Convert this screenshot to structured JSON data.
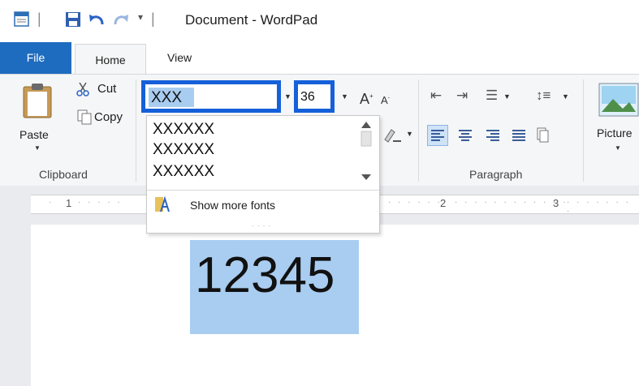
{
  "window": {
    "title": "Document - WordPad"
  },
  "tabs": {
    "file": "File",
    "home": "Home",
    "view": "View"
  },
  "clipboard": {
    "paste": "Paste",
    "cut": "Cut",
    "copy": "Copy",
    "group_label": "Clipboard"
  },
  "font": {
    "name_value": "XXX",
    "size_value": "36",
    "dropdown_items": [
      "XXXXXX",
      "XXXXXX",
      "XXXXXX"
    ],
    "show_more": "Show more fonts"
  },
  "paragraph": {
    "group_label": "Paragraph"
  },
  "insert": {
    "picture": "Picture"
  },
  "ruler": {
    "marks": [
      "1",
      "2",
      "3"
    ]
  },
  "document": {
    "text": "12345"
  },
  "colors": {
    "accent": "#1e6cbf",
    "highlight_box": "#1560d9",
    "selection": "#a9cdf0"
  },
  "icons": [
    "app-icon",
    "save-icon",
    "undo-icon",
    "redo-icon",
    "customize-qat-icon",
    "paste-icon",
    "cut-icon",
    "copy-icon",
    "grow-font-icon",
    "shrink-font-icon",
    "decrease-indent-icon",
    "increase-indent-icon",
    "bullets-icon",
    "line-spacing-icon",
    "align-left-icon",
    "align-center-icon",
    "align-right-icon",
    "justify-icon",
    "paragraph-icon",
    "picture-icon",
    "highlight-icon",
    "scroll-up-icon",
    "scroll-down-icon",
    "font-icon"
  ]
}
